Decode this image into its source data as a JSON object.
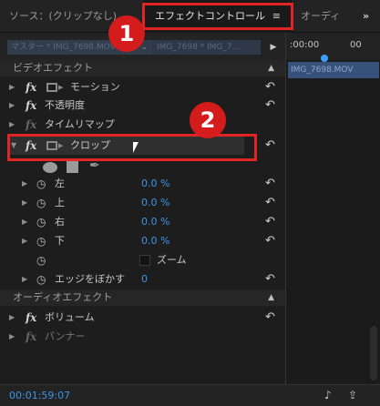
{
  "tabs": {
    "source": "ソース：(クリップなし)",
    "effect_controls": "エフェクトコントロール",
    "effect_controls_menu": "≡",
    "audio": "オーディ",
    "more": "»"
  },
  "source_row": {
    "sequence_label": "マスター * IMG_7698.MOV",
    "clip_label": "IMG_7698 * IMG_7...",
    "play_icon": "triangle-right-icon"
  },
  "timeline": {
    "start_time": ":00:00",
    "end_time": "00",
    "clip_name": "IMG_7698.MOV"
  },
  "video_effects": {
    "header": "ビデオエフェクト",
    "items": [
      {
        "fx": "fx",
        "label": "モーション"
      },
      {
        "fx": "fx",
        "label": "不透明度"
      },
      {
        "fx": "fx",
        "label": "タイムリマップ"
      },
      {
        "fx": "fx",
        "label": "クロップ"
      }
    ],
    "crop_params": [
      {
        "label": "左",
        "value": "0.0 %"
      },
      {
        "label": "上",
        "value": "0.0 %"
      },
      {
        "label": "右",
        "value": "0.0 %"
      },
      {
        "label": "下",
        "value": "0.0 %"
      }
    ],
    "zoom_label": "ズーム",
    "feather_label": "エッジをぼかす",
    "feather_value": "0"
  },
  "audio_effects": {
    "header": "オーディオエフェクト",
    "items": [
      {
        "fx": "fx",
        "label": "ボリューム"
      },
      {
        "fx": "fx",
        "label": "パンナー"
      }
    ]
  },
  "callouts": {
    "one": "1",
    "two": "2"
  },
  "bottom": {
    "timecode": "00:01:59:07"
  },
  "glyphs": {
    "reset": "↶",
    "stopwatch": "◷",
    "tri_right": "▶",
    "tri_down": "▼",
    "up": "▲",
    "pen": "✒"
  },
  "colors": {
    "accent_blue": "#3e95e6",
    "highlight_red": "#e02525",
    "clip_blue": "#37527a"
  }
}
